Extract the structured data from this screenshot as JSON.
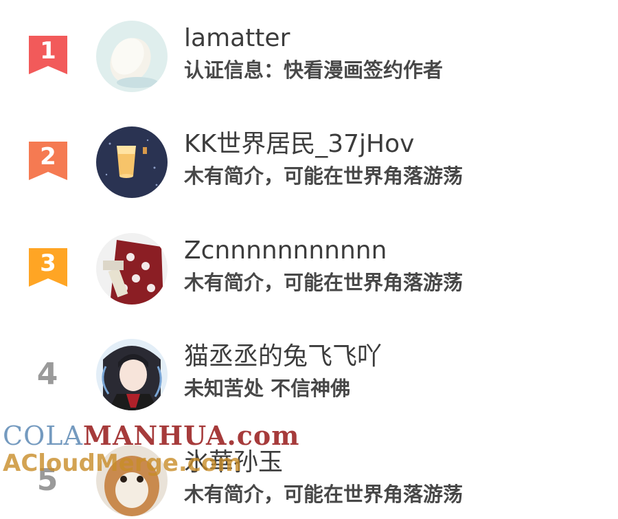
{
  "ranking": [
    {
      "rank": "1",
      "badge_color": "#f25a5a",
      "name": "lamatter",
      "desc": "认证信息：快看漫画签约作者"
    },
    {
      "rank": "2",
      "badge_color": "#f57a52",
      "name": "KK世界居民_37jHov",
      "desc": "木有简介，可能在世界角落游荡"
    },
    {
      "rank": "3",
      "badge_color": "#ffa524",
      "name": "Zcnnnnnnnnnnn",
      "desc": "木有简介，可能在世界角落游荡"
    },
    {
      "rank": "4",
      "name": "猫丞丞的兔飞飞吖",
      "desc": "未知苦处 不信神佛"
    },
    {
      "rank": "5",
      "name": "氷華孙玉",
      "desc": "木有简介，可能在世界角落游荡"
    }
  ],
  "watermark": {
    "cola": "COLA",
    "manhua": "MANHUA",
    "com": ".com",
    "line2": "ACloudMerge.com"
  }
}
